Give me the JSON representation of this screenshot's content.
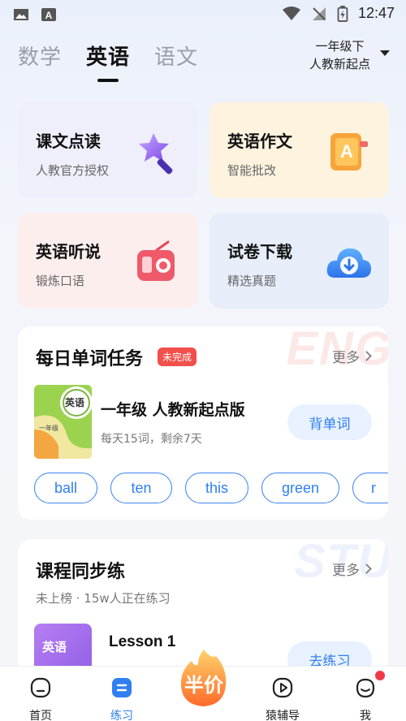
{
  "status": {
    "time": "12:47"
  },
  "subjects": [
    "数学",
    "英语",
    "语文"
  ],
  "active_subject": "英语",
  "grade": {
    "line1": "一年级下",
    "line2": "人教新起点"
  },
  "features": [
    {
      "title": "课文点读",
      "sub": "人教官方授权",
      "icon": "magic-wand-icon"
    },
    {
      "title": "英语作文",
      "sub": "智能批改",
      "icon": "letter-book-icon"
    },
    {
      "title": "英语听说",
      "sub": "锻炼口语",
      "icon": "radio-icon"
    },
    {
      "title": "试卷下载",
      "sub": "精选真题",
      "icon": "cloud-download-icon"
    }
  ],
  "daily": {
    "title": "每日单词任务",
    "badge": "未完成",
    "more": "更多",
    "watermark": "ENG",
    "book_title": "一年级 人教新起点版",
    "book_sub": "每天15词，剩余7天",
    "cover_label": "英语",
    "cover_grade": "一年级",
    "button": "背单词",
    "words": [
      "ball",
      "ten",
      "this",
      "green",
      "r"
    ]
  },
  "course": {
    "title": "课程同步练",
    "more": "更多",
    "watermark": "STU",
    "sub": "未上榜 · 15w人正在练习",
    "thumb_label": "英语",
    "lesson": "Lesson 1",
    "button": "去练习"
  },
  "nav": {
    "home": "首页",
    "practice": "练习",
    "promo": "半价",
    "tutor": "猿辅导",
    "me": "我"
  },
  "colors": {
    "accent": "#2f7ff2",
    "badge": "#f2504a"
  }
}
